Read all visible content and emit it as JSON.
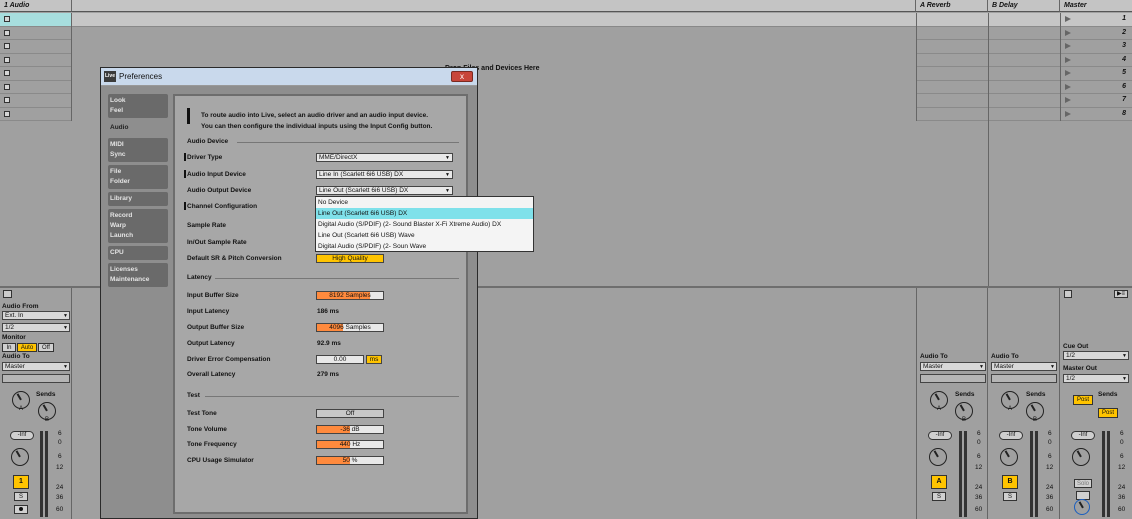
{
  "tracks": {
    "audio_name": "1 Audio",
    "a_reverb": "A Reverb",
    "b_delay": "B Delay",
    "master": "Master",
    "drop_hint": "Drop Files and Devices Here",
    "scenes": [
      "1",
      "2",
      "3",
      "4",
      "5",
      "6",
      "7",
      "8"
    ]
  },
  "mixer": {
    "audio_from_label": "Audio From",
    "audio_from_value": "Ext. In",
    "input_channel": "1/2",
    "monitor_label": "Monitor",
    "monitor_in": "In",
    "monitor_auto": "Auto",
    "monitor_off": "Off",
    "audio_to_label": "Audio To",
    "audio_to_value": "Master",
    "sends_label": "Sends",
    "knob_a": "A",
    "knob_b": "B",
    "vol": "-Inf",
    "track_num": "1",
    "solo": "S",
    "scale": [
      "6",
      "0",
      "6",
      "12",
      "24",
      "36",
      "60"
    ],
    "return_a_letter": "A",
    "return_b_letter": "B",
    "cue_out_label": "Cue Out",
    "cue_out_value": "1/2",
    "master_out_label": "Master Out",
    "master_out_value": "1/2",
    "post": "Post",
    "solo_word": "Solo"
  },
  "dialog": {
    "title": "Preferences",
    "logo": "Live",
    "close": "x",
    "tabs": [
      "Look\nFeel",
      "Audio",
      "MIDI\nSync",
      "File\nFolder",
      "Library",
      "Record\nWarp\nLaunch",
      "CPU",
      "Licenses\nMaintenance"
    ],
    "info_line1": "To route audio into Live, select an audio driver and an audio input device.",
    "info_line2": "You can then configure the individual inputs using the Input Config button.",
    "section_audio_device": "Audio Device",
    "driver_type_label": "Driver Type",
    "driver_type_value": "MME/DirectX",
    "input_device_label": "Audio Input Device",
    "input_device_value": "Line In (Scarlett 6i6 USB) DX",
    "output_device_label": "Audio Output Device",
    "output_device_value": "Line Out (Scarlett 6i6 USB) DX",
    "channel_config_label": "Channel Configuration",
    "section_sample_rate": "Sample Rate",
    "io_rate_label": "In/Out Sample Rate",
    "src_label": "Default SR & Pitch Conversion",
    "src_value": "High Quality",
    "section_latency": "Latency",
    "input_buffer_label": "Input Buffer Size",
    "input_buffer_value": "8192 Samples",
    "input_buffer_fill": 0.8,
    "input_latency_label": "Input Latency",
    "input_latency_value": "186 ms",
    "output_buffer_label": "Output Buffer Size",
    "output_buffer_value": "4096 Samples",
    "output_buffer_fill": 0.4,
    "output_latency_label": "Output Latency",
    "output_latency_value": "92.9 ms",
    "driver_comp_label": "Driver Error Compensation",
    "driver_comp_value": "0.00",
    "driver_comp_unit": "ms",
    "overall_latency_label": "Overall Latency",
    "overall_latency_value": "279 ms",
    "section_test": "Test",
    "test_tone_label": "Test Tone",
    "test_tone_value": "Off",
    "tone_volume_label": "Tone Volume",
    "tone_volume_value": "-36 dB",
    "tone_volume_fill": 0.5,
    "tone_freq_label": "Tone Frequency",
    "tone_freq_value": "440 Hz",
    "tone_freq_fill": 0.5,
    "cpu_sim_label": "CPU Usage Simulator",
    "cpu_sim_value": "50 %",
    "cpu_sim_fill": 0.5
  },
  "output_popup": {
    "items": [
      "No Device",
      "Line Out (Scarlett 6i6 USB) DX",
      "Digital Audio (S/PDIF) (2- Sound Blaster X-Fi Xtreme Audio) DX",
      "Line Out (Scarlett 6i6 USB) Wave",
      "Digital Audio (S/PDIF) (2- Soun Wave"
    ],
    "selected_index": 1
  },
  "colors": {
    "accent_orange": "#ff8a3d",
    "yellow": "#ffc400",
    "highlight_cyan": "#7fe1ea"
  }
}
